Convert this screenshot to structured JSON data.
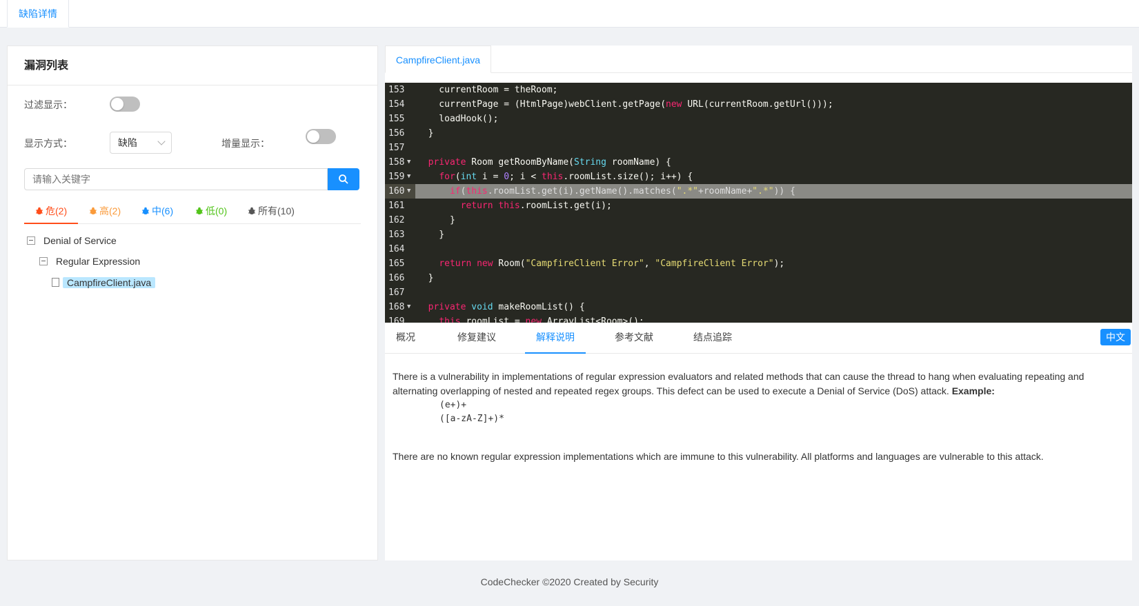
{
  "top_tab": "缺陷详情",
  "left_panel": {
    "title": "漏洞列表",
    "filter_label": "过滤显示：",
    "display_label": "显示方式：",
    "display_value": "缺陷",
    "increment_label": "增量显示：",
    "search_placeholder": "请输入关键字",
    "severity_tabs": [
      {
        "label": "危(2)",
        "color": "#ff4d1a"
      },
      {
        "label": "高(2)",
        "color": "#fa9a3a"
      },
      {
        "label": "中(6)",
        "color": "#1890ff"
      },
      {
        "label": "低(0)",
        "color": "#52c41a"
      },
      {
        "label": "所有(10)",
        "color": "#555555"
      }
    ],
    "tree": {
      "category": "Denial of Service",
      "subcategory": "Regular Expression",
      "file": "CampfireClient.java"
    }
  },
  "file_tab": "CampfireClient.java",
  "code_lines": [
    "153",
    "154",
    "155",
    "156",
    "157",
    "158",
    "159",
    "160",
    "161",
    "162",
    "163",
    "164",
    "165",
    "166",
    "167",
    "168",
    "169"
  ],
  "detail_tabs": [
    "概况",
    "修复建议",
    "解释说明",
    "参考文献",
    "结点追踪"
  ],
  "lang_button": "中文",
  "description": {
    "paragraph1": "There is a vulnerability in implementations of regular expression evaluators and related methods that can cause the thread to hang when evaluating repeating and alternating overlapping of nested and repeated regex groups. This defect can be used to execute a Denial of Service (DoS) attack.",
    "example_label": "Example:",
    "example1": "(e+)+",
    "example2": "([a-zA-Z]+)*",
    "paragraph2": "There are no known regular expression implementations which are immune to this vulnerability. All platforms and languages are vulnerable to this attack."
  },
  "footer": "CodeChecker ©2020 Created by Security"
}
